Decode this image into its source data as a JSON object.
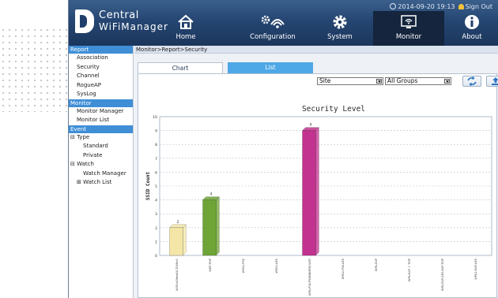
{
  "header": {
    "brand_line1": "Central",
    "brand_line2": "WiFiManager",
    "datetime": "2014-09-20 19:13",
    "signout": "Sign Out",
    "nav": [
      {
        "label": "Home",
        "icon": "home-icon"
      },
      {
        "label": "Configuration",
        "icon": "configuration-icon"
      },
      {
        "label": "System",
        "icon": "gear-icon"
      },
      {
        "label": "Monitor",
        "icon": "monitor-icon"
      },
      {
        "label": "About",
        "icon": "info-icon"
      }
    ],
    "active_nav": "Monitor"
  },
  "sidebar": {
    "report_head": "Report",
    "report_items": [
      "Association",
      "Security",
      "Channel",
      "RogueAP",
      "SysLog"
    ],
    "monitor_head": "Monitor",
    "monitor_items": [
      "Monitor Manager",
      "Monitor List"
    ],
    "event_head": "Event",
    "type_label": "Type",
    "type_toggle": "⊟",
    "type_items": [
      "Standard",
      "Private"
    ],
    "watch_label": "Watch",
    "watch_toggle": "⊟",
    "watch_manager": "Watch Manager",
    "watch_list": "Watch List",
    "watch_list_toggle": "⊞"
  },
  "main": {
    "breadcrumb": "Monitor>Report>Security",
    "tabs": [
      {
        "label": "Chart"
      },
      {
        "label": "List"
      }
    ],
    "filter_site": "Site",
    "filter_groups": "All Groups"
  },
  "colors": {
    "header_dark": "#1b365b",
    "sidebar_head": "#3f8ed6",
    "tab_inactive": "#4ea7e6",
    "bar_yellow": "#f3e6a6",
    "bar_green": "#6fa436",
    "bar_magenta": "#c2338f"
  },
  "chart_data": {
    "type": "bar",
    "title": "Security Level",
    "ylabel": "SSID Count",
    "ylim": [
      0,
      10
    ],
    "yticks": [
      0,
      1,
      2,
      3,
      4,
      5,
      6,
      7,
      8,
      9,
      10
    ],
    "grid": true,
    "categories": [
      "WiFiAnONetAU-TLRNv1",
      "WEP-TKIP",
      "WPA2-PSK",
      "WPA2-AES",
      "WPA-PSK-PSNNNdPSK-WIFI",
      "WPA2-PSK-AES",
      "WPA-EAP",
      "WPA-EAP + TKIP",
      "WPA-EAP-AES-EAP-TKIP",
      "WPA2-EAP-AES"
    ],
    "values": [
      2,
      4,
      0,
      0,
      9,
      0,
      0,
      0,
      0,
      0
    ],
    "bar_colors": [
      "#f3e6a6",
      "#6fa436",
      "#cccccc",
      "#cccccc",
      "#c2338f",
      "#cccccc",
      "#cccccc",
      "#cccccc",
      "#cccccc",
      "#cccccc"
    ],
    "data_labels": [
      "2",
      "4",
      "",
      "",
      "9",
      "",
      "",
      "",
      "",
      ""
    ]
  }
}
